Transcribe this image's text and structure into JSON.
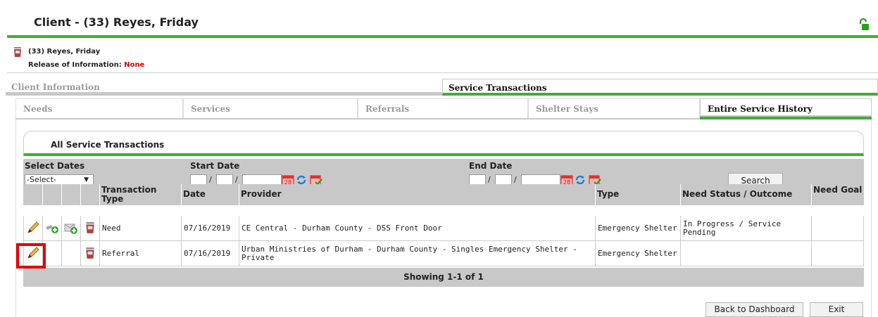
{
  "header": {
    "title": "Client - (33) Reyes, Friday"
  },
  "client": {
    "name": "(33) Reyes, Friday",
    "roi_label": "Release of Information:",
    "roi_value": "None"
  },
  "main_tabs": [
    {
      "label": "Client Information",
      "active": false
    },
    {
      "label": "Service Transactions",
      "active": true
    }
  ],
  "sub_tabs": [
    {
      "label": "Needs",
      "active": false
    },
    {
      "label": "Services",
      "active": false
    },
    {
      "label": "Referrals",
      "active": false
    },
    {
      "label": "Shelter Stays",
      "active": false
    },
    {
      "label": "Entire Service History",
      "active": true
    }
  ],
  "panel": {
    "title": "All Service Transactions"
  },
  "filters": {
    "select_dates_label": "Select Dates",
    "select_value": "-Select-",
    "start_date_label": "Start Date",
    "end_date_label": "End Date",
    "date_separator": "/",
    "search_label": "Search"
  },
  "table": {
    "headers": [
      "Transaction Type",
      "Date",
      "Provider",
      "Type",
      "Need Status / Outcome",
      "Need Goal"
    ],
    "rows": [
      {
        "transaction_type": "Need",
        "date": "07/16/2019",
        "provider": "CE Central - Durham County - DSS Front Door",
        "type": "Emergency Shelter",
        "status": "In Progress / Service Pending",
        "goal": ""
      },
      {
        "transaction_type": "Referral",
        "date": "07/16/2019",
        "provider": "Urban Ministries of Durham - Durham County - Singles Emergency Shelter - Private",
        "type": "Emergency Shelter",
        "status": "",
        "goal": ""
      }
    ],
    "footer": "Showing 1-1 of 1"
  },
  "buttons": {
    "back": "Back to Dashboard",
    "exit": "Exit"
  },
  "colors": {
    "accent_green": "#3cb034",
    "highlight_red": "#e60000",
    "none_red": "#d60000",
    "header_gray": "#c8c8c8"
  }
}
